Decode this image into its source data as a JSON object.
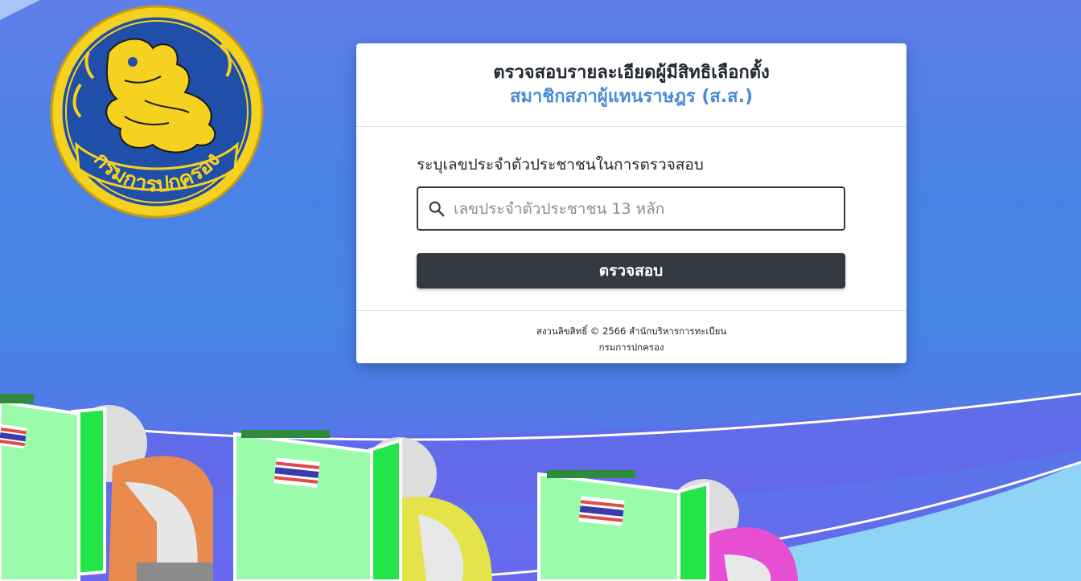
{
  "header": {
    "title": "ตรวจสอบรายละเอียดผู้มีสิทธิเลือกตั้ง",
    "subtitle": "สมาชิกสภาผู้แทนราษฎร (ส.ส.)"
  },
  "form": {
    "label": "ระบุเลขประจำตัวประชาชนในการตรวจสอบ",
    "id_input": {
      "placeholder": "เลขประจำตัวประชาชน 13 หลัก",
      "value": ""
    },
    "submit_label": "ตรวจสอบ"
  },
  "footer": {
    "copyright": "สงวนลิขสิทธิ์ © 2566 สำนักบริหารการทะเบียน",
    "department": "กรมการปกครอง"
  },
  "seal": {
    "text": "กรมการปกครอง",
    "icon": "department-of-provincial-administration-seal"
  },
  "icons": {
    "search": "search-icon"
  },
  "colors": {
    "background": "#4a82e6",
    "title": "#222831",
    "subtitle_accent": "#4a8ad6",
    "button": "#353841",
    "seal_blue": "#1f4fa8",
    "seal_gold": "#f4d21f",
    "booth_green": "#9afbab",
    "booth_bright_green": "#22e548"
  }
}
